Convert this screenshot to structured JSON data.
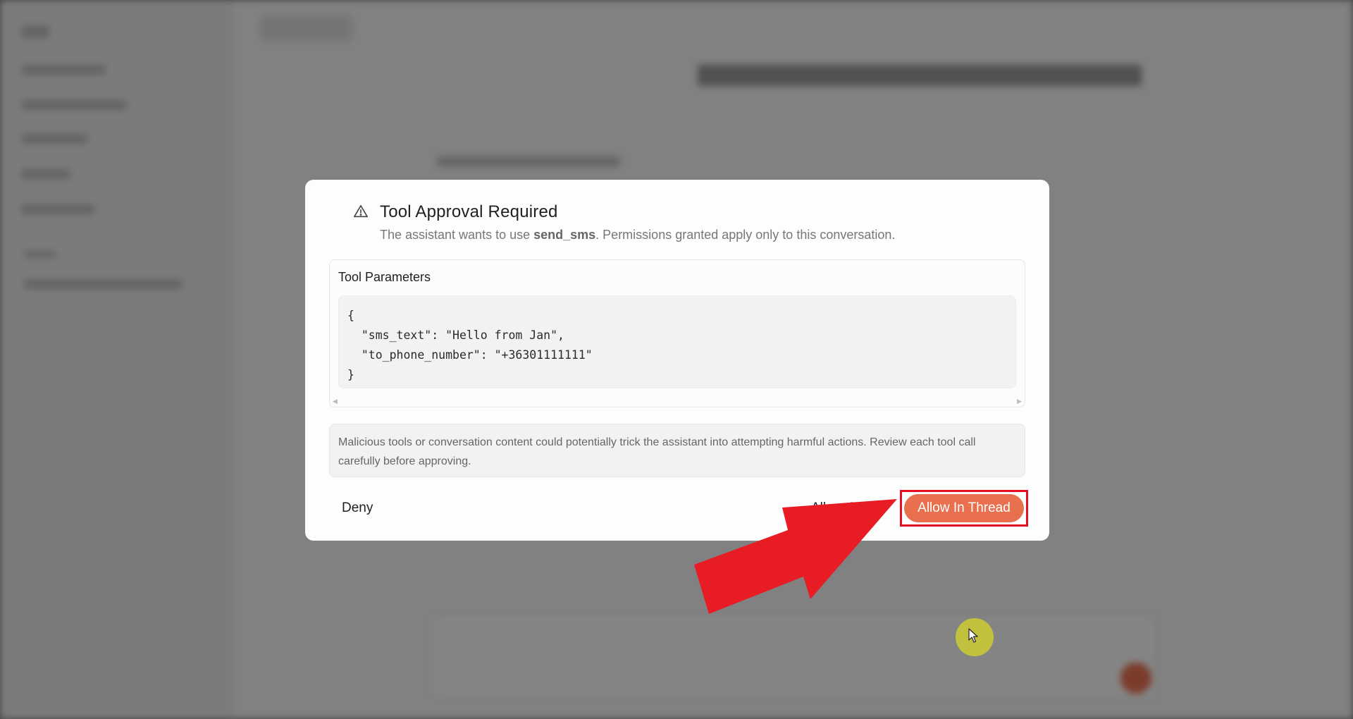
{
  "dialog": {
    "icon": "warning-triangle-icon",
    "title": "Tool Approval Required",
    "subtitle_prefix": "The assistant wants to use ",
    "tool_name": "send_sms",
    "subtitle_suffix": ". Permissions granted apply only to this conversation.",
    "params_title": "Tool Parameters",
    "params_code": "{\n  \"sms_text\": \"Hello from Jan\",\n  \"to_phone_number\": \"+36301111111\"\n}",
    "warning_text": "Malicious tools or conversation content could potentially trick the assistant into attempting harmful actions. Review each tool call carefully before approving.",
    "buttons": {
      "deny": "Deny",
      "allow_once": "Allow Once",
      "allow_in_thread": "Allow In Thread"
    }
  },
  "colors": {
    "primary_button": "#e9704f",
    "highlight_box": "#e3101f",
    "annotation_arrow": "#e81c24",
    "cursor_highlight": "#d6d628"
  }
}
